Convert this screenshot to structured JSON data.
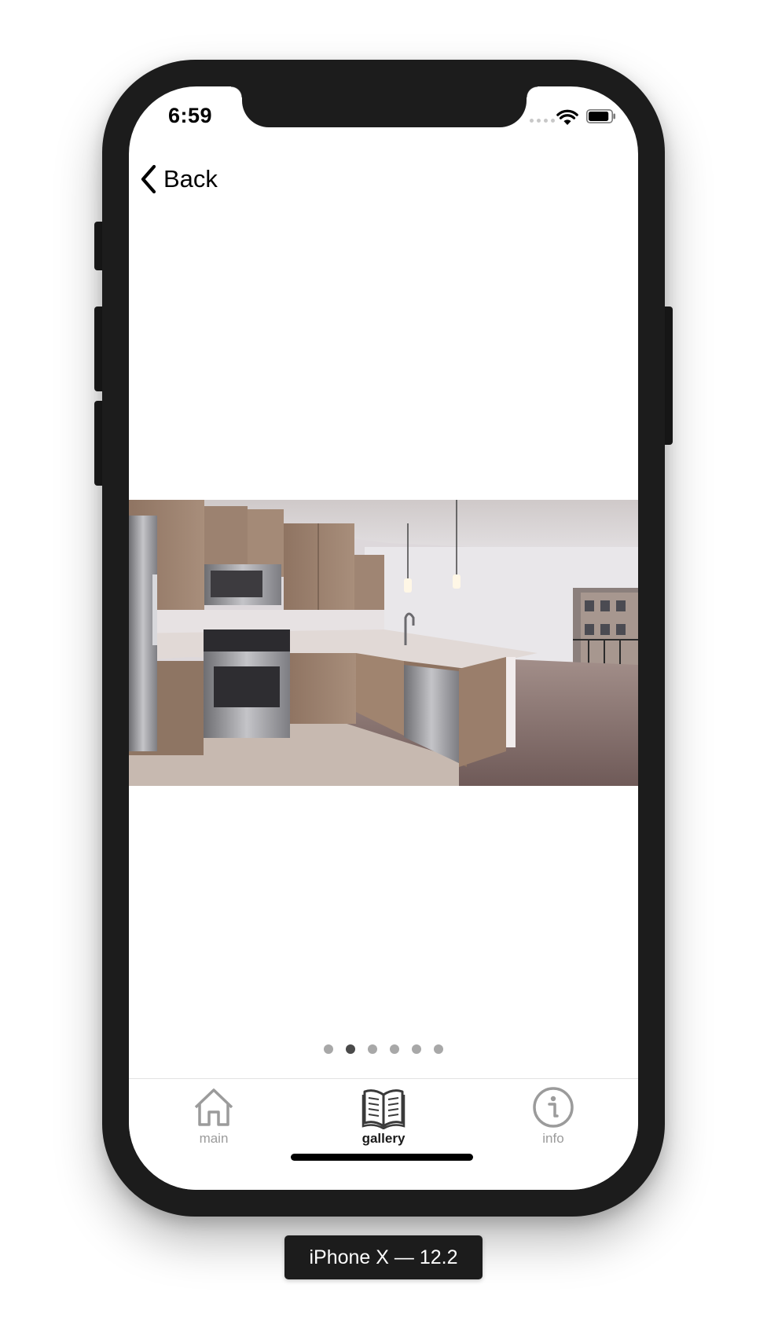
{
  "status_bar": {
    "time": "6:59",
    "signal_icon": "signal-dots-icon",
    "wifi_icon": "wifi-icon",
    "battery_icon": "battery-icon",
    "battery_level": 0.9
  },
  "navigation": {
    "back_label": "Back",
    "back_icon": "chevron-left-icon"
  },
  "gallery": {
    "image_alt": "kitchen photo",
    "page_count": 6,
    "current_page": 2
  },
  "tab_bar": {
    "tabs": [
      {
        "label": "main",
        "icon": "home-icon",
        "selected": false
      },
      {
        "label": "gallery",
        "icon": "book-icon",
        "selected": true
      },
      {
        "label": "info",
        "icon": "info-icon",
        "selected": false
      }
    ]
  },
  "device_label": "iPhone X — 12.2",
  "colors": {
    "frame": "#1c1c1c",
    "tab_inactive": "#9b9b9b",
    "tab_active": "#1a1a1a",
    "dot_inactive": "#a8a8a8",
    "dot_active": "#4a4a4a"
  }
}
